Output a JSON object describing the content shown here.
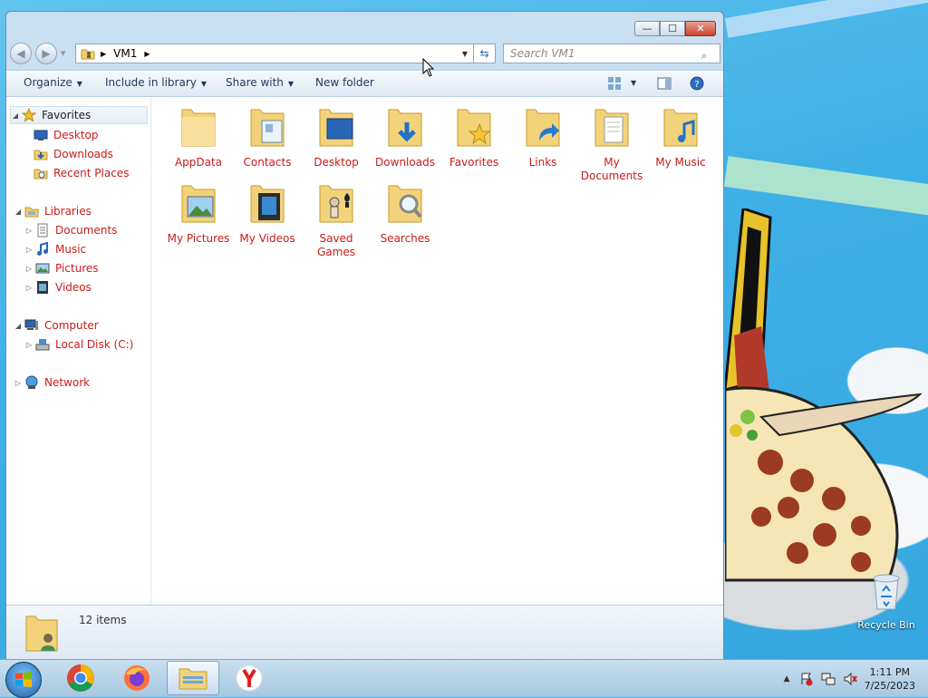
{
  "window": {
    "caption": {
      "minimize": "—",
      "maximize": "☐",
      "close": "✕"
    },
    "address": {
      "path": [
        "VM1"
      ]
    },
    "search": {
      "placeholder": "Search VM1"
    },
    "toolbar": {
      "organize": "Organize",
      "include": "Include in library",
      "share": "Share with",
      "new_folder": "New folder"
    },
    "navpane": {
      "favorites": {
        "label": "Favorites",
        "items": [
          "Desktop",
          "Downloads",
          "Recent Places"
        ]
      },
      "libraries": {
        "label": "Libraries",
        "items": [
          "Documents",
          "Music",
          "Pictures",
          "Videos"
        ]
      },
      "computer": {
        "label": "Computer",
        "items": [
          "Local Disk (C:)"
        ]
      },
      "network": {
        "label": "Network"
      }
    },
    "files": [
      {
        "name": "AppData",
        "icon": "folder-icon"
      },
      {
        "name": "Contacts",
        "icon": "contacts-folder-icon"
      },
      {
        "name": "Desktop",
        "icon": "desktop-folder-icon"
      },
      {
        "name": "Downloads",
        "icon": "downloads-folder-icon"
      },
      {
        "name": "Favorites",
        "icon": "favorites-folder-icon"
      },
      {
        "name": "Links",
        "icon": "links-folder-icon"
      },
      {
        "name": "My Documents",
        "icon": "documents-folder-icon"
      },
      {
        "name": "My Music",
        "icon": "music-folder-icon"
      },
      {
        "name": "My Pictures",
        "icon": "pictures-folder-icon"
      },
      {
        "name": "My Videos",
        "icon": "videos-folder-icon"
      },
      {
        "name": "Saved Games",
        "icon": "games-folder-icon"
      },
      {
        "name": "Searches",
        "icon": "searches-folder-icon"
      }
    ],
    "details": {
      "count": "12 items"
    }
  },
  "desktop": {
    "recycle_bin": "Recycle Bin"
  },
  "taskbar": {
    "apps": [
      "chrome-icon",
      "firefox-icon",
      "explorer-icon",
      "yandex-icon"
    ],
    "clock": {
      "time": "1:11 PM",
      "date": "7/25/2023"
    }
  },
  "colors": {
    "link_text": "#cc1a1a",
    "accent": "#3a6db0"
  }
}
